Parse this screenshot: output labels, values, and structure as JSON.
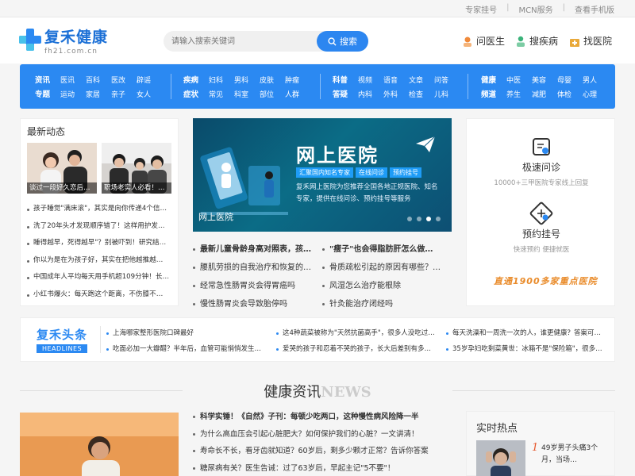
{
  "topbar": {
    "links": [
      "专家挂号",
      "MCN服务",
      "查看手机版"
    ]
  },
  "logo": {
    "cn": "复禾健康",
    "en": "fh21.com.cn"
  },
  "search": {
    "placeholder": "请输入搜索关键词",
    "button": "搜索"
  },
  "header_nav": [
    {
      "label": "问医生",
      "color": "#f08a3a"
    },
    {
      "label": "搜疾病",
      "color": "#3bb37a"
    },
    {
      "label": "找医院",
      "color": "#e9a93a"
    }
  ],
  "catnav": [
    {
      "rows": [
        {
          "head": "资讯",
          "items": [
            "医讯",
            "百科",
            "医改",
            "辟谣"
          ]
        },
        {
          "head": "专题",
          "items": [
            "运动",
            "家居",
            "亲子",
            "女人"
          ]
        }
      ]
    },
    {
      "rows": [
        {
          "head": "疾病",
          "items": [
            "妇科",
            "男科",
            "皮肤",
            "肿瘤"
          ]
        },
        {
          "head": "症状",
          "items": [
            "常见",
            "科室",
            "部位",
            "人群"
          ]
        }
      ]
    },
    {
      "rows": [
        {
          "head": "科普",
          "items": [
            "视频",
            "语音",
            "文章",
            "问答"
          ]
        },
        {
          "head": "答疑",
          "items": [
            "内科",
            "外科",
            "检查",
            "儿科"
          ]
        }
      ]
    },
    {
      "rows": [
        {
          "head": "健康",
          "items": [
            "中医",
            "美容",
            "母婴",
            "男人"
          ]
        },
        {
          "head": "频道",
          "items": [
            "养生",
            "减肥",
            "体检",
            "心理"
          ]
        }
      ]
    }
  ],
  "latest": {
    "title": "最新动态",
    "thumbs": [
      "谈过一段好久恋后…",
      "职场老实人必看！…"
    ],
    "items": [
      "孩子睡觉\"满床滚\"，其实是向你传递4个信…",
      "洗了20年头才发现顺序错了！这样用护发…",
      "睡得越早，死得越早\"？别被吓到！研究结…",
      "你以为是在为孩子好，其实在把他越推越…",
      "中国成年人平均每天用手机超109分钟！长…",
      "小红书爆火：每天跑这个距离，不伤膝不…"
    ]
  },
  "banner": {
    "headline": "网上医院",
    "tags": [
      "汇聚国内知名专家",
      "在线问诊",
      "预约挂号"
    ],
    "desc": "复禾网上医院为您推荐全国各地正规医院、知名专家，提供在线问诊、预约挂号等服务",
    "caption": "网上医院"
  },
  "mid_left": [
    "最新儿童骨龄身高对照表，孩…",
    "腰肌劳损的自我治疗和恢复的…",
    "经常急性肠胃炎会得胃癌吗",
    "慢性肠胃炎会导致胎停吗"
  ],
  "mid_right": [
    "\"瘦子\"也会得脂肪肝怎么做…",
    "骨质疏松引起的原因有哪些？…",
    "风湿怎么治疗能根除",
    "针灸能治疗闭经吗"
  ],
  "services": [
    {
      "title": "极速问诊",
      "sub": "10000+三甲医院专家线上回复"
    },
    {
      "title": "预约挂号",
      "sub": "快速预约  便捷就医"
    }
  ],
  "promo": "直通1900多家重点医院",
  "headlines": {
    "cn": "复禾头条",
    "en": "HEADLINES",
    "cols": [
      [
        "上海哪家整形医院口碑最好",
        "吃面必加一大瓣醋？半年后，血管可能悄悄发生…"
      ],
      [
        "这4种蔬菜被称为\"天然抗菌高手\"，很多人没吃过…",
        "爱哭的孩子和忍着不哭的孩子，长大后差别有多…"
      ],
      [
        "每天洗澡和一周洗一次的人，谁更健康？答案可…",
        "35岁孕妇吃剩菜黄世：冰箱不是\"保险箱\"，很多…"
      ]
    ]
  },
  "news_section": {
    "cn": "健康资讯",
    "en": "NEWS"
  },
  "news_list": [
    "科学实锤！《自然》子刊：每顿少吃两口，这种慢性病风险降一半",
    "为什么高血压会引起心脏肥大？如何保护我们的心脏？一文讲清！",
    "寿命长不长，看牙齿就知道？60岁后，剩多少颗才正常？告诉你答案",
    "糖尿病有关？医生告诫：过了63岁后，早起主记\"5不要\"！"
  ],
  "hot": {
    "title": "实时热点",
    "num": "1",
    "text": "49岁男子头痛3个月，当场…"
  }
}
